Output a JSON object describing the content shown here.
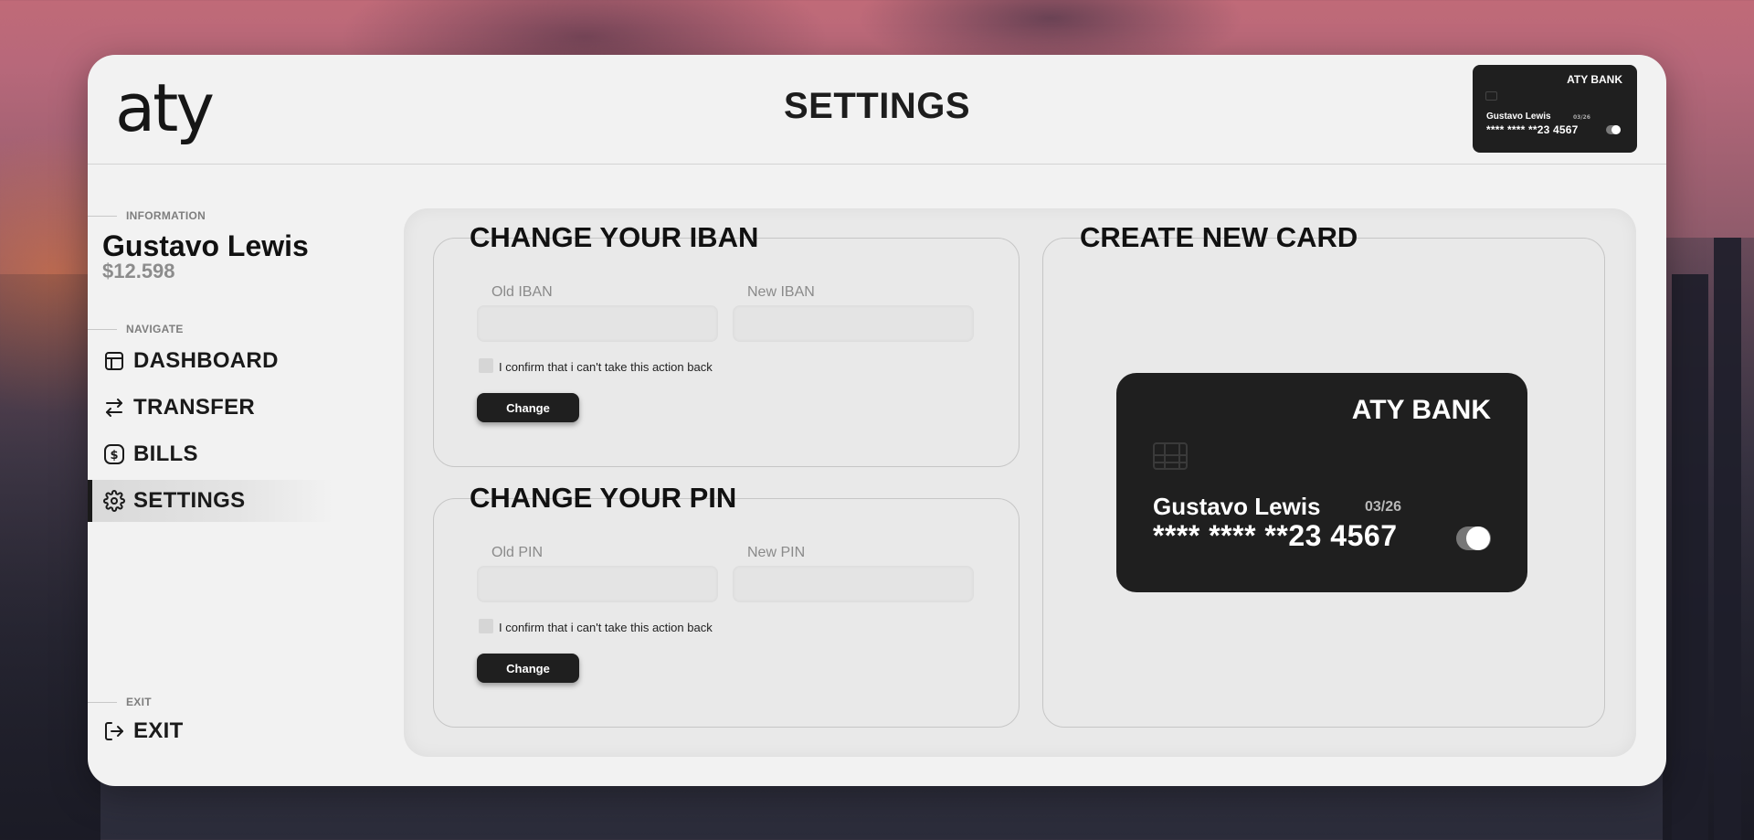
{
  "app": {
    "logo": "aty",
    "page_title": "SETTINGS"
  },
  "header_card": {
    "bank": "ATY BANK",
    "holder": "Gustavo Lewis",
    "expiry": "03/26",
    "number": "**** **** **23 4567"
  },
  "sidebar": {
    "info_label": "INFORMATION",
    "user_name": "Gustavo Lewis",
    "balance": "$12.598",
    "navigate_label": "NAVIGATE",
    "items": [
      {
        "label": "DASHBOARD",
        "icon": "dashboard-icon"
      },
      {
        "label": "TRANSFER",
        "icon": "transfer-icon"
      },
      {
        "label": "BILLS",
        "icon": "dollar-icon"
      },
      {
        "label": "SETTINGS",
        "icon": "gear-icon",
        "active": true
      }
    ],
    "exit_label": "EXIT",
    "exit_item": "EXIT"
  },
  "iban": {
    "title": "CHANGE YOUR IBAN",
    "old_label": "Old IBAN",
    "new_label": "New IBAN",
    "old_value": "",
    "new_value": "",
    "confirm_text": "I confirm that i can't take this action back",
    "button": "Change"
  },
  "pin": {
    "title": "CHANGE YOUR PIN",
    "old_label": "Old PIN",
    "new_label": "New PIN",
    "old_value": "",
    "new_value": "",
    "confirm_text": "I confirm that i can't take this action back",
    "button": "Change"
  },
  "new_card": {
    "title": "CREATE NEW CARD",
    "bank": "ATY BANK",
    "holder": "Gustavo Lewis",
    "expiry": "03/26",
    "number": "**** **** **23 4567"
  },
  "colors": {
    "window_bg": "#f2f2f2",
    "card_bg": "#1f1f1f",
    "accent": "#1a1a1a",
    "muted": "#8a8a8a"
  }
}
